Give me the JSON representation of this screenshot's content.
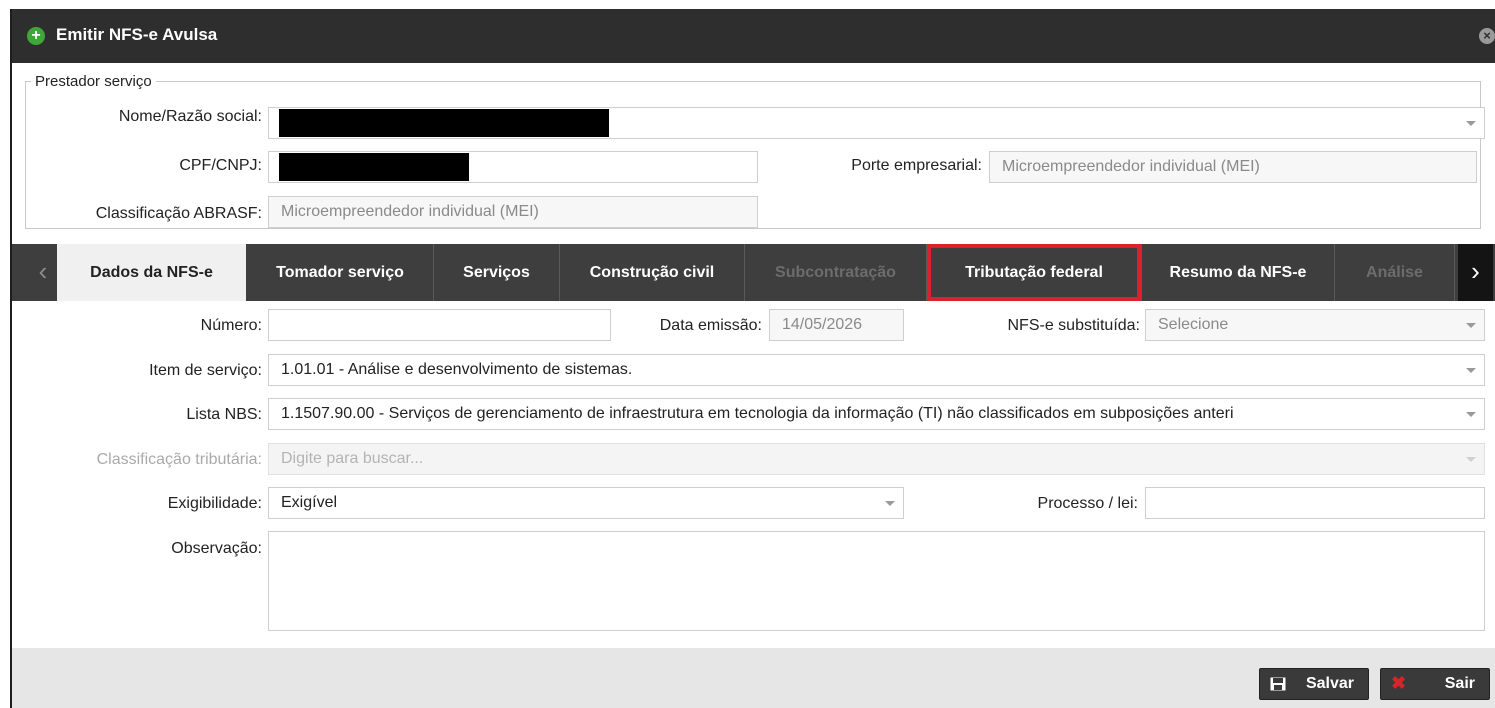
{
  "window": {
    "title": "Emitir NFS-e Avulsa"
  },
  "prestador": {
    "legend": "Prestador serviço",
    "nome_label": "Nome/Razão social:",
    "cpf_label": "CPF/CNPJ:",
    "porte_label": "Porte empresarial:",
    "porte_value": "Microempreendedor individual (MEI)",
    "classif_label": "Classificação ABRASF:",
    "classif_value": "Microempreendedor individual (MEI)"
  },
  "tabs": [
    {
      "label": "Dados da NFS-e",
      "state": "active"
    },
    {
      "label": "Tomador serviço",
      "state": "normal"
    },
    {
      "label": "Serviços",
      "state": "normal"
    },
    {
      "label": "Construção civil",
      "state": "normal"
    },
    {
      "label": "Subcontratação",
      "state": "disabled"
    },
    {
      "label": "Tributação federal",
      "state": "highlighted"
    },
    {
      "label": "Resumo da NFS-e",
      "state": "normal"
    },
    {
      "label": "Análise",
      "state": "disabled"
    }
  ],
  "form": {
    "numero_label": "Número:",
    "numero_value": "",
    "data_label": "Data emissão:",
    "data_value": "14/05/2026",
    "subst_label": "NFS-e substituída:",
    "subst_value": "Selecione",
    "item_label": "Item de serviço:",
    "item_value": "1.01.01 - Análise e desenvolvimento de sistemas.",
    "nbs_label": "Lista NBS:",
    "nbs_value": "1.1507.90.00 - Serviços de gerenciamento de infraestrutura em tecnologia da informação (TI) não classificados em subposições anteri",
    "class_trib_label": "Classificação tributária:",
    "class_trib_placeholder": "Digite para buscar...",
    "exig_label": "Exigibilidade:",
    "exig_value": "Exigível",
    "processo_label": "Processo / lei:",
    "processo_value": "",
    "obs_label": "Observação:",
    "obs_value": ""
  },
  "footer": {
    "save_label": "Salvar",
    "exit_label": "Sair"
  },
  "colors": {
    "titlebar": "#2e2e2e",
    "tabbar": "#3e3e3e",
    "highlight": "#d9222a",
    "plus": "#3fa639",
    "exit_x": "#d9222a"
  },
  "icons": {
    "title": "plus-circle-icon",
    "close": "close-circle-icon",
    "save": "floppy-disk-icon",
    "exit": "x-icon"
  }
}
